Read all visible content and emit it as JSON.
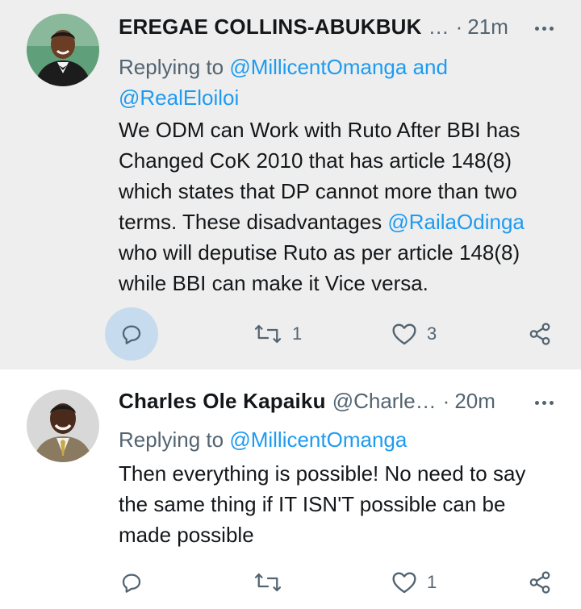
{
  "tweets": [
    {
      "author_name": "EREGAE COLLINS-ABUKBUK",
      "author_handle": "…",
      "time": "21m",
      "replying_prefix": "Replying to ",
      "replying_line1_mention": "@MillicentOmanga",
      "replying_line1_suffix": " and",
      "replying_line2_mention": "@RealEloiloi",
      "body": [
        {
          "text": "We ODM can Work with Ruto After BBI has"
        },
        {
          "text": "Changed CoK 2010 that has article  148(8)"
        },
        {
          "text": "which states that DP cannot more than two"
        },
        {
          "text": "terms. These disadvantages ",
          "mention": "@RailaOdinga"
        },
        {
          "text": "who will deputise Ruto as per article 148(8)"
        },
        {
          "text": "while BBI can make it Vice versa."
        }
      ],
      "retweets": "1",
      "likes": "3"
    },
    {
      "author_name": "Charles Ole Kapaiku",
      "author_handle": "@Charle…",
      "time": "20m",
      "replying_prefix": "Replying to ",
      "replying_line1_mention": "@MillicentOmanga",
      "body": [
        {
          "text": "Then everything is possible! No need to say"
        },
        {
          "text": "the same thing if IT ISN'T possible can be"
        },
        {
          "text": "made possible"
        }
      ],
      "retweets": "",
      "likes": "1"
    }
  ],
  "icons": {
    "reply": "reply-icon",
    "retweet": "retweet-icon",
    "like": "heart-icon",
    "share": "share-icon",
    "more": "more-icon"
  },
  "colors": {
    "mention": "#1d9bf0",
    "secondary_text": "#536471",
    "highlight_bg": "#eeeeee",
    "reply_active_bg": "#c6dbee"
  }
}
